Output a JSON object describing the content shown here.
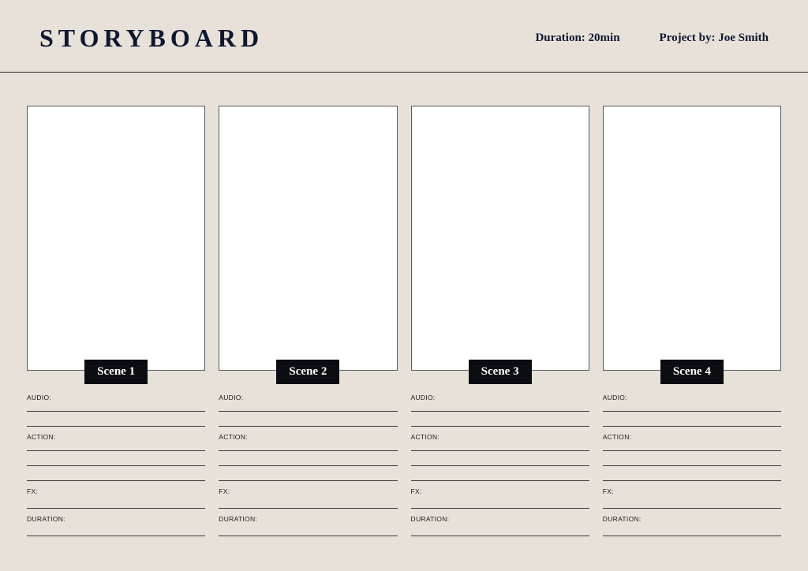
{
  "header": {
    "title": "STORYBOARD",
    "duration": "Duration: 20min",
    "project_by": "Project by: Joe Smith"
  },
  "field_labels": {
    "audio": "AUDIO:",
    "action": "ACTION:",
    "fx": "FX:",
    "duration": "DURATION:"
  },
  "panels": [
    {
      "scene_label": "Scene 1"
    },
    {
      "scene_label": "Scene 2"
    },
    {
      "scene_label": "Scene 3"
    },
    {
      "scene_label": "Scene 4"
    }
  ]
}
